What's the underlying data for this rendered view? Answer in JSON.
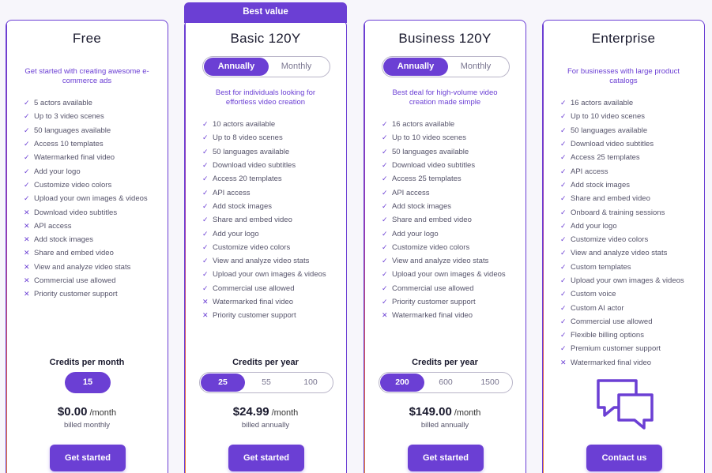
{
  "badge": "Best value",
  "plans": [
    {
      "title": "Free",
      "description": "Get started with creating awesome e-commerce ads",
      "features": [
        {
          "label": "5 actors available",
          "included": true
        },
        {
          "label": "Up to 3 video scenes",
          "included": true
        },
        {
          "label": "50 languages available",
          "included": true
        },
        {
          "label": "Access 10 templates",
          "included": true
        },
        {
          "label": "Watermarked final video",
          "included": true
        },
        {
          "label": "Add your logo",
          "included": true
        },
        {
          "label": "Customize video colors",
          "included": true
        },
        {
          "label": "Upload your own images & videos",
          "included": true
        },
        {
          "label": "Download video subtitles",
          "included": false
        },
        {
          "label": "API access",
          "included": false
        },
        {
          "label": "Add stock images",
          "included": false
        },
        {
          "label": "Share and embed video",
          "included": false
        },
        {
          "label": "View and analyze video stats",
          "included": false
        },
        {
          "label": "Commercial use allowed",
          "included": false
        },
        {
          "label": "Priority customer support",
          "included": false
        }
      ],
      "credits_label": "Credits per month",
      "credits_options": [
        "15"
      ],
      "price": "$0.00",
      "price_period": "/month",
      "billed": "billed monthly",
      "cta": "Get started"
    },
    {
      "title": "Basic 120Y",
      "toggle": {
        "annually": "Annually",
        "monthly": "Monthly",
        "selected": "Annually"
      },
      "description": "Best for individuals looking for effortless video creation",
      "features": [
        {
          "label": "10 actors available",
          "included": true
        },
        {
          "label": "Up to 8 video scenes",
          "included": true
        },
        {
          "label": "50 languages available",
          "included": true
        },
        {
          "label": "Download video subtitles",
          "included": true
        },
        {
          "label": "Access 20 templates",
          "included": true
        },
        {
          "label": "API access",
          "included": true
        },
        {
          "label": "Add stock images",
          "included": true
        },
        {
          "label": "Share and embed video",
          "included": true
        },
        {
          "label": "Add your logo",
          "included": true
        },
        {
          "label": "Customize video colors",
          "included": true
        },
        {
          "label": "View and analyze video stats",
          "included": true
        },
        {
          "label": "Upload your own images & videos",
          "included": true
        },
        {
          "label": "Commercial use allowed",
          "included": true
        },
        {
          "label": "Watermarked final video",
          "included": false
        },
        {
          "label": "Priority customer support",
          "included": false
        }
      ],
      "credits_label": "Credits per year",
      "credits_options": [
        "25",
        "55",
        "100"
      ],
      "price": "$24.99",
      "price_period": "/month",
      "billed": "billed annually",
      "cta": "Get started"
    },
    {
      "title": "Business 120Y",
      "toggle": {
        "annually": "Annually",
        "monthly": "Monthly",
        "selected": "Annually"
      },
      "description": "Best deal for high-volume video creation made simple",
      "features": [
        {
          "label": "16 actors available",
          "included": true
        },
        {
          "label": "Up to 10 video scenes",
          "included": true
        },
        {
          "label": "50 languages available",
          "included": true
        },
        {
          "label": "Download video subtitles",
          "included": true
        },
        {
          "label": "Access 25 templates",
          "included": true
        },
        {
          "label": "API access",
          "included": true
        },
        {
          "label": "Add stock images",
          "included": true
        },
        {
          "label": "Share and embed video",
          "included": true
        },
        {
          "label": "Add your logo",
          "included": true
        },
        {
          "label": "Customize video colors",
          "included": true
        },
        {
          "label": "View and analyze video stats",
          "included": true
        },
        {
          "label": "Upload your own images & videos",
          "included": true
        },
        {
          "label": "Commercial use allowed",
          "included": true
        },
        {
          "label": "Priority customer support",
          "included": true
        },
        {
          "label": "Watermarked final video",
          "included": false
        }
      ],
      "credits_label": "Credits per year",
      "credits_options": [
        "200",
        "600",
        "1500"
      ],
      "price": "$149.00",
      "price_period": "/month",
      "billed": "billed annually",
      "cta": "Get started"
    },
    {
      "title": "Enterprise",
      "description": "For businesses with large product catalogs",
      "features": [
        {
          "label": "16 actors available",
          "included": true
        },
        {
          "label": "Up to 10 video scenes",
          "included": true
        },
        {
          "label": "50 languages available",
          "included": true
        },
        {
          "label": "Download video subtitles",
          "included": true
        },
        {
          "label": "Access 25 templates",
          "included": true
        },
        {
          "label": "API access",
          "included": true
        },
        {
          "label": "Add stock images",
          "included": true
        },
        {
          "label": "Share and embed video",
          "included": true
        },
        {
          "label": "Onboard & training sessions",
          "included": true
        },
        {
          "label": "Add your logo",
          "included": true
        },
        {
          "label": "Customize video colors",
          "included": true
        },
        {
          "label": "View and analyze video stats",
          "included": true
        },
        {
          "label": "Custom templates",
          "included": true
        },
        {
          "label": "Upload your own images & videos",
          "included": true
        },
        {
          "label": "Custom voice",
          "included": true
        },
        {
          "label": "Custom AI actor",
          "included": true
        },
        {
          "label": "Commercial use allowed",
          "included": true
        },
        {
          "label": "Flexible billing options",
          "included": true
        },
        {
          "label": "Premium customer support",
          "included": true
        },
        {
          "label": "Watermarked final video",
          "included": false
        }
      ],
      "icon": "chat-bubbles-icon",
      "cta": "Contact us"
    }
  ],
  "colors": {
    "accent": "#6b3fd4",
    "text": "#1a1a2e",
    "muted": "#55536a"
  }
}
